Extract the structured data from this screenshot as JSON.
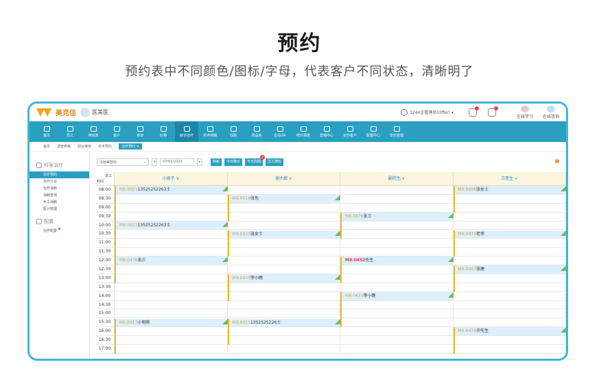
{
  "page": {
    "title": "预约",
    "subtitle": "预约表中不同颜色/图标/字母，代表客户不同状态，清晰明了"
  },
  "app": {
    "logo_text": "美克佳",
    "clinic_name": "医美医",
    "user_label": "3244企管理员(Offer) ▾",
    "top_links": [
      "在线学习",
      "在线咨询"
    ]
  },
  "nav": {
    "items": [
      "首页",
      "员工",
      "排班表",
      "客户",
      "咨询",
      "价格",
      "就诊治疗",
      "手术排期",
      "住院",
      "药品库",
      "企业OA",
      "统计报表",
      "营销中心",
      "合作客户",
      "配置中心",
      "安全管理"
    ],
    "active_index": 6
  },
  "breadcrumbs": [
    "首页",
    "调查表格",
    "前台接待",
    "手术预约",
    "治疗预约 ×"
  ],
  "sidebar": {
    "group1": "科室治疗",
    "items1": [
      "治疗预约",
      "治疗分诊",
      "治疗消耗",
      "消耗查询",
      "手工消耗",
      "医计管理"
    ],
    "active_index": 0,
    "group2": "配置",
    "items2": [
      "治疗配置"
    ]
  },
  "toolbar": {
    "department": "注射美容科",
    "date": "07/01/2022",
    "prev": "◂",
    "next": "▸",
    "buttons": [
      "刷新",
      "今日确诊",
      "今日改期",
      "员工排班"
    ],
    "badge": "2"
  },
  "schedule": {
    "corner_top": "员工",
    "corner_bottom": "时间",
    "staff": [
      "小周子 ∨",
      "谢大娘 ∨",
      "副院生 ∨",
      "方医生 ∨"
    ],
    "times": [
      "08:00",
      "08:30",
      "09:00",
      "09:30",
      "10:00",
      "10:30",
      "11:00",
      "11:30",
      "12:00",
      "12:30",
      "13:00",
      "13:30",
      "14:00",
      "14:30",
      "15:00",
      "15:30",
      "16:00",
      "16:30",
      "17:00"
    ],
    "appointments": [
      {
        "col": 0,
        "row": 0,
        "span": 5,
        "code": "MX-0021",
        "text": "13525252263士",
        "status": "normal"
      },
      {
        "col": 0,
        "row": 4,
        "span": 4,
        "code": "MX-0021",
        "text": "13525252263士",
        "status": "normal"
      },
      {
        "col": 0,
        "row": 8,
        "span": 3,
        "code": "MX-0476",
        "text": "张三",
        "status": "normal"
      },
      {
        "col": 0,
        "row": 15,
        "span": 4,
        "code": "MX-0017",
        "text": "小明称",
        "status": "normal"
      },
      {
        "col": 1,
        "row": 1,
        "span": 3,
        "code": "MX-0018",
        "text": "张先",
        "status": "normal"
      },
      {
        "col": 1,
        "row": 5,
        "span": 3,
        "code": "MX-0433",
        "text": "张女士",
        "status": "normal"
      },
      {
        "col": 1,
        "row": 10,
        "span": 3,
        "code": "MX-0433",
        "text": "李小晚",
        "status": "normal"
      },
      {
        "col": 1,
        "row": 15,
        "span": 3,
        "code": "MX-0021",
        "text": "1352525226士",
        "status": "normal"
      },
      {
        "col": 2,
        "row": 3,
        "span": 3,
        "code": "MX-0476",
        "text": "张三",
        "status": "normal"
      },
      {
        "col": 2,
        "row": 8,
        "span": 3,
        "code": "MX-0452",
        "text": "先生",
        "status": "red"
      },
      {
        "col": 2,
        "row": 12,
        "span": 4,
        "code": "MX-0433",
        "text": "李小晚",
        "status": "normal"
      },
      {
        "col": 3,
        "row": 0,
        "span": 3,
        "code": "MX-0458",
        "text": "张女士",
        "status": "normal"
      },
      {
        "col": 3,
        "row": 5,
        "span": 3,
        "code": "MX-0473",
        "text": "老李",
        "status": "normal"
      },
      {
        "col": 3,
        "row": 9,
        "span": 3,
        "code": "MX-0467",
        "text": "张建",
        "status": "normal"
      },
      {
        "col": 3,
        "row": 16,
        "span": 3,
        "code": "MX-0474",
        "text": "许先生",
        "status": "normal"
      }
    ]
  }
}
